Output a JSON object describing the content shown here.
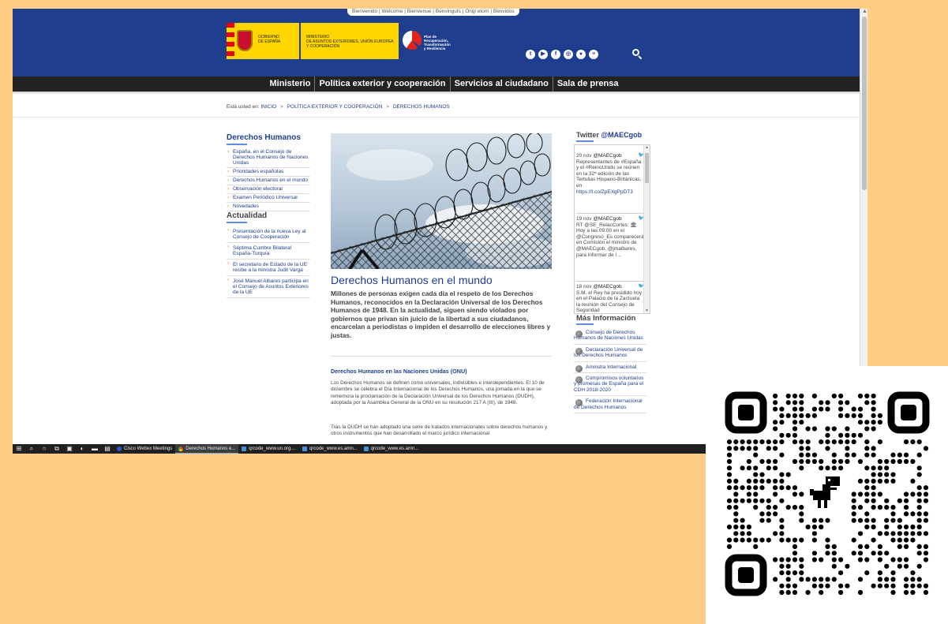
{
  "header": {
    "welcome": "Bienvenido | Welcome | Bienvenue | Benvinguts | Ongi etorri | Benvidos",
    "gov_logo_text": "GOBIERNO\nDE ESPAÑA",
    "ministry_logo_text": "MINISTERIO\nDE ASUNTOS EXTERIORES, UNIÓN EUROPEA\nY COOPERACIÓN",
    "plan_logo_text": "Plan de\nRecuperación,\nTransformación\ny Resiliencia"
  },
  "social_icons": [
    "twitter-icon",
    "youtube-icon",
    "facebook-icon",
    "instagram-icon",
    "flickr-icon",
    "spotify-icon"
  ],
  "nav": {
    "items": [
      "Ministerio",
      "Política exterior y cooperación",
      "Servicios al ciudadano",
      "Sala de prensa"
    ]
  },
  "breadcrumb": {
    "prefix": "Está usted en:",
    "items": [
      "INICIO",
      "POLÍTICA EXTERIOR Y COOPERACIÓN",
      "DERECHOS HUMANOS"
    ],
    "separator": ">"
  },
  "sidebar": {
    "title": "Derechos Humanos",
    "items": [
      "España, en el Consejo de Derechos Humanos de Naciones Unidas",
      "Prioridades españolas",
      "Derechos Humanos en el mundo",
      "Observación electoral",
      "Examen Periódico Universal",
      "Novedades"
    ],
    "actualidad_title": "Actualidad",
    "actualidad_items": [
      "Presentación de la nueva Ley al Consejo de Cooperación",
      "Séptima Cumbre Bilateral España-Turquía",
      "El secretario de Estado de la UE recibe a la ministra Judit Varga",
      "José Manuel Albares participa en el Consejo de Asuntos Exteriores de la UE"
    ]
  },
  "main": {
    "title": "Derechos Humanos en el mundo",
    "lead": "Millones de personas exigen cada día el respeto de los Derechos Humanos, reconocidos en la Declaración Universal de los Derechos Humanos de 1948. En la actualidad, siguen siendo violados por gobiernos que privan sin juicio de la libertad a sus ciudadanos, encarcelan a periodistas o impiden el desarrollo de elecciones libres y justas.",
    "section_title": "Derechos Humanos en las Naciones Unidas (ONU)",
    "p1": "Los Derechos Humanos se definen como universales, indivisibles e interdependientes. El 10 de diciembre se celebra el Día Internacional de los Derechos Humanos, una jornada en la que se rememora la proclamación de la Declaración Universal de los Derechos Humanos (DUDH), adoptada por la Asamblea General de la ONU en su resolución 217 A (III), de 1948.",
    "p2": "Tras la DUDH se han adoptado una serie de tratados internacionales sobre derechos humanos y otros instrumentos que han desarrollado el marco jurídico internacional"
  },
  "twitter": {
    "label": "Twitter",
    "handle": "@MAECgob",
    "tweets": [
      {
        "date": "20 nov",
        "user": "@MAECgob",
        "text": "Representantes de #España y el #ReinoUnido se reúnen en la 32ª edición de las Tertulias Hispano-Británicas, en",
        "link": "https://t.co/ZpEXgPpDT3"
      },
      {
        "date": "19 nov",
        "user": "@MAECgob",
        "text": "RT @SE_RelacCortes: 🏛Hoy a las 09:00 en el @Congreso_Es comparecerá en Comisión el ministro de @MAECgob, @jmalbares, para informar de l…",
        "link": ""
      },
      {
        "date": "18 nov",
        "user": "@MAECgob",
        "text": "S.M. el Rey ha presidido hoy en el Palacio de la Zarzuela la reunión del Consejo de Seguridad",
        "link": ""
      }
    ]
  },
  "mas_info": {
    "title": "Más Información",
    "items": [
      "Consejo de Derechos Humanos de Naciones Unidas",
      "Declaración Universal de los Derechos Humanos",
      "Amnistía Internacional",
      "Compromisos voluntarios y promesas de España para el CDH 2018-2020",
      "Federación Internacional de Derechos Humanos"
    ]
  },
  "taskbar": {
    "apps": [
      {
        "label": "Cisco Webex Meetings",
        "icon": "webex-icon",
        "active": false
      },
      {
        "label": "Derechos Humanos e...",
        "icon": "chrome-icon",
        "active": true
      },
      {
        "label": "qrcode_www.un.org....",
        "icon": "image-icon",
        "active": false
      },
      {
        "label": "qrcode_www.es.amn...",
        "icon": "image-icon",
        "active": false
      },
      {
        "label": "qrcode_www.es.amn...",
        "icon": "image-icon",
        "active": false
      }
    ]
  },
  "colors": {
    "background": "#FFCD85",
    "header_blue": "#1f3e8e",
    "nav_black": "#222222",
    "accent_blue": "#5b8ee0"
  }
}
